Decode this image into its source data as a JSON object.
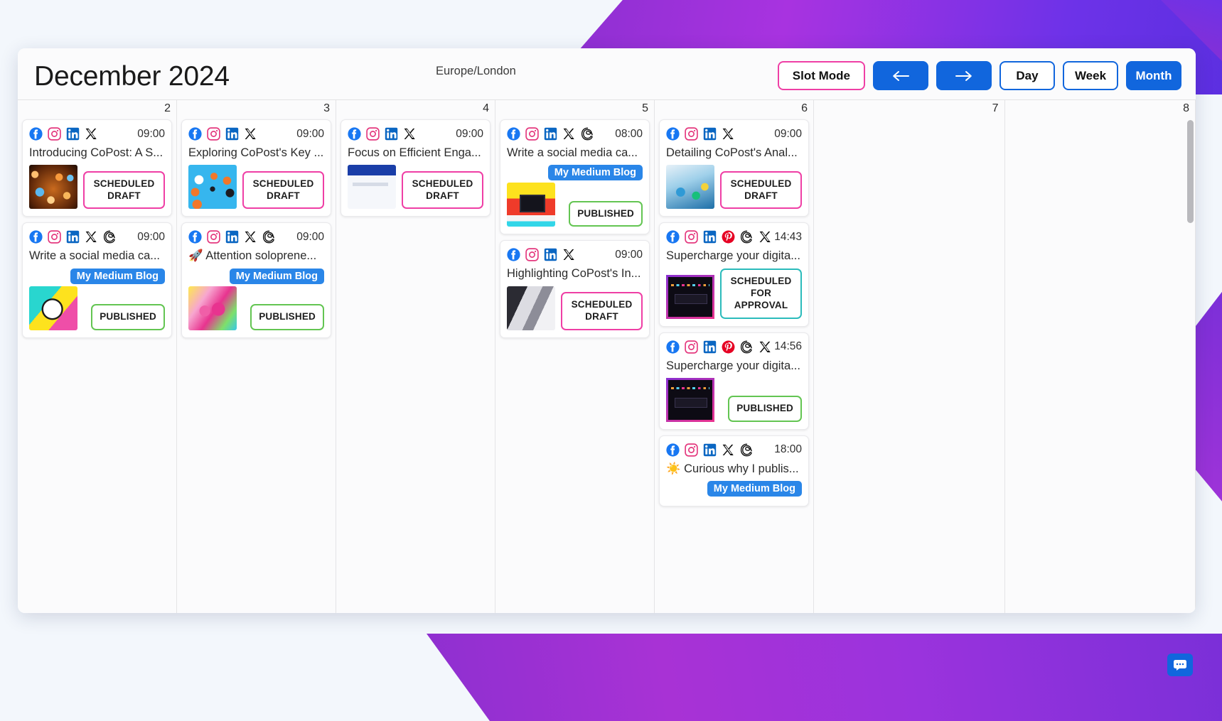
{
  "header": {
    "title": "December 2024",
    "timezone": "Europe/London",
    "slot_mode_label": "Slot Mode",
    "prev_label": "←",
    "next_label": "→",
    "day_label": "Day",
    "week_label": "Week",
    "month_label": "Month",
    "active_view": "Month",
    "accent_blue": "#1166dd",
    "accent_pink": "#ef3fa5",
    "accent_green": "#63c552",
    "accent_teal": "#2bbbbb"
  },
  "columns": [
    {
      "day": "2",
      "events": [
        {
          "platforms": [
            "facebook",
            "instagram",
            "linkedin",
            "x"
          ],
          "time": "09:00",
          "title": "Introducing CoPost: A S...",
          "status": "SCHEDULED DRAFT",
          "status_kind": "draft",
          "thumb": "t-net",
          "blog_tag": null
        },
        {
          "platforms": [
            "facebook",
            "instagram",
            "linkedin",
            "x",
            "threads"
          ],
          "time": "09:00",
          "title": "Write a social media ca...",
          "status": "PUBLISHED",
          "status_kind": "published",
          "thumb": "t-clock",
          "blog_tag": "My Medium Blog"
        }
      ]
    },
    {
      "day": "3",
      "events": [
        {
          "platforms": [
            "facebook",
            "instagram",
            "linkedin",
            "x"
          ],
          "time": "09:00",
          "title": "Exploring CoPost's Key ...",
          "status": "SCHEDULED DRAFT",
          "status_kind": "draft",
          "thumb": "t-hub",
          "blog_tag": null
        },
        {
          "platforms": [
            "facebook",
            "instagram",
            "linkedin",
            "x",
            "threads"
          ],
          "time": "09:00",
          "title": "🚀 Attention soloprene...",
          "status": "PUBLISHED",
          "status_kind": "published",
          "thumb": "t-pink",
          "blog_tag": "My Medium Blog"
        }
      ]
    },
    {
      "day": "4",
      "events": [
        {
          "platforms": [
            "facebook",
            "instagram",
            "linkedin",
            "x"
          ],
          "time": "09:00",
          "title": "Focus on Efficient Enga...",
          "status": "SCHEDULED DRAFT",
          "status_kind": "draft",
          "thumb": "t-ui",
          "blog_tag": null
        }
      ]
    },
    {
      "day": "5",
      "events": [
        {
          "platforms": [
            "facebook",
            "instagram",
            "linkedin",
            "x",
            "threads"
          ],
          "time": "08:00",
          "title": "Write a social media ca...",
          "status": "PUBLISHED",
          "status_kind": "published",
          "thumb": "t-desk",
          "blog_tag": "My Medium Blog"
        },
        {
          "platforms": [
            "facebook",
            "instagram",
            "linkedin",
            "x"
          ],
          "time": "09:00",
          "title": "Highlighting CoPost's In...",
          "status": "SCHEDULED DRAFT",
          "status_kind": "draft",
          "thumb": "t-collage",
          "blog_tag": null
        }
      ]
    },
    {
      "day": "6",
      "events": [
        {
          "platforms": [
            "facebook",
            "instagram",
            "linkedin",
            "x"
          ],
          "time": "09:00",
          "title": "Detailing CoPost's Anal...",
          "status": "SCHEDULED DRAFT",
          "status_kind": "draft",
          "thumb": "t-analytics",
          "blog_tag": null
        },
        {
          "platforms": [
            "facebook",
            "instagram",
            "linkedin",
            "pinterest",
            "threads",
            "x"
          ],
          "time": "14:43",
          "title": "Supercharge your digita...",
          "status": "SCHEDULED FOR APPROVAL",
          "status_kind": "approval",
          "thumb": "t-dark-ui",
          "blog_tag": null
        },
        {
          "platforms": [
            "facebook",
            "instagram",
            "linkedin",
            "pinterest",
            "threads",
            "x"
          ],
          "time": "14:56",
          "title": "Supercharge your digita...",
          "status": "PUBLISHED",
          "status_kind": "published",
          "thumb": "t-dark-ui",
          "blog_tag": null
        },
        {
          "platforms": [
            "facebook",
            "instagram",
            "linkedin",
            "x",
            "threads"
          ],
          "time": "18:00",
          "title": "☀️ Curious why I publis...",
          "status": null,
          "status_kind": null,
          "thumb": null,
          "blog_tag": "My Medium Blog"
        }
      ]
    },
    {
      "day": "7",
      "events": []
    },
    {
      "day": "8",
      "events": []
    }
  ],
  "chat_fab": {
    "icon": "chat-bubble-icon"
  }
}
